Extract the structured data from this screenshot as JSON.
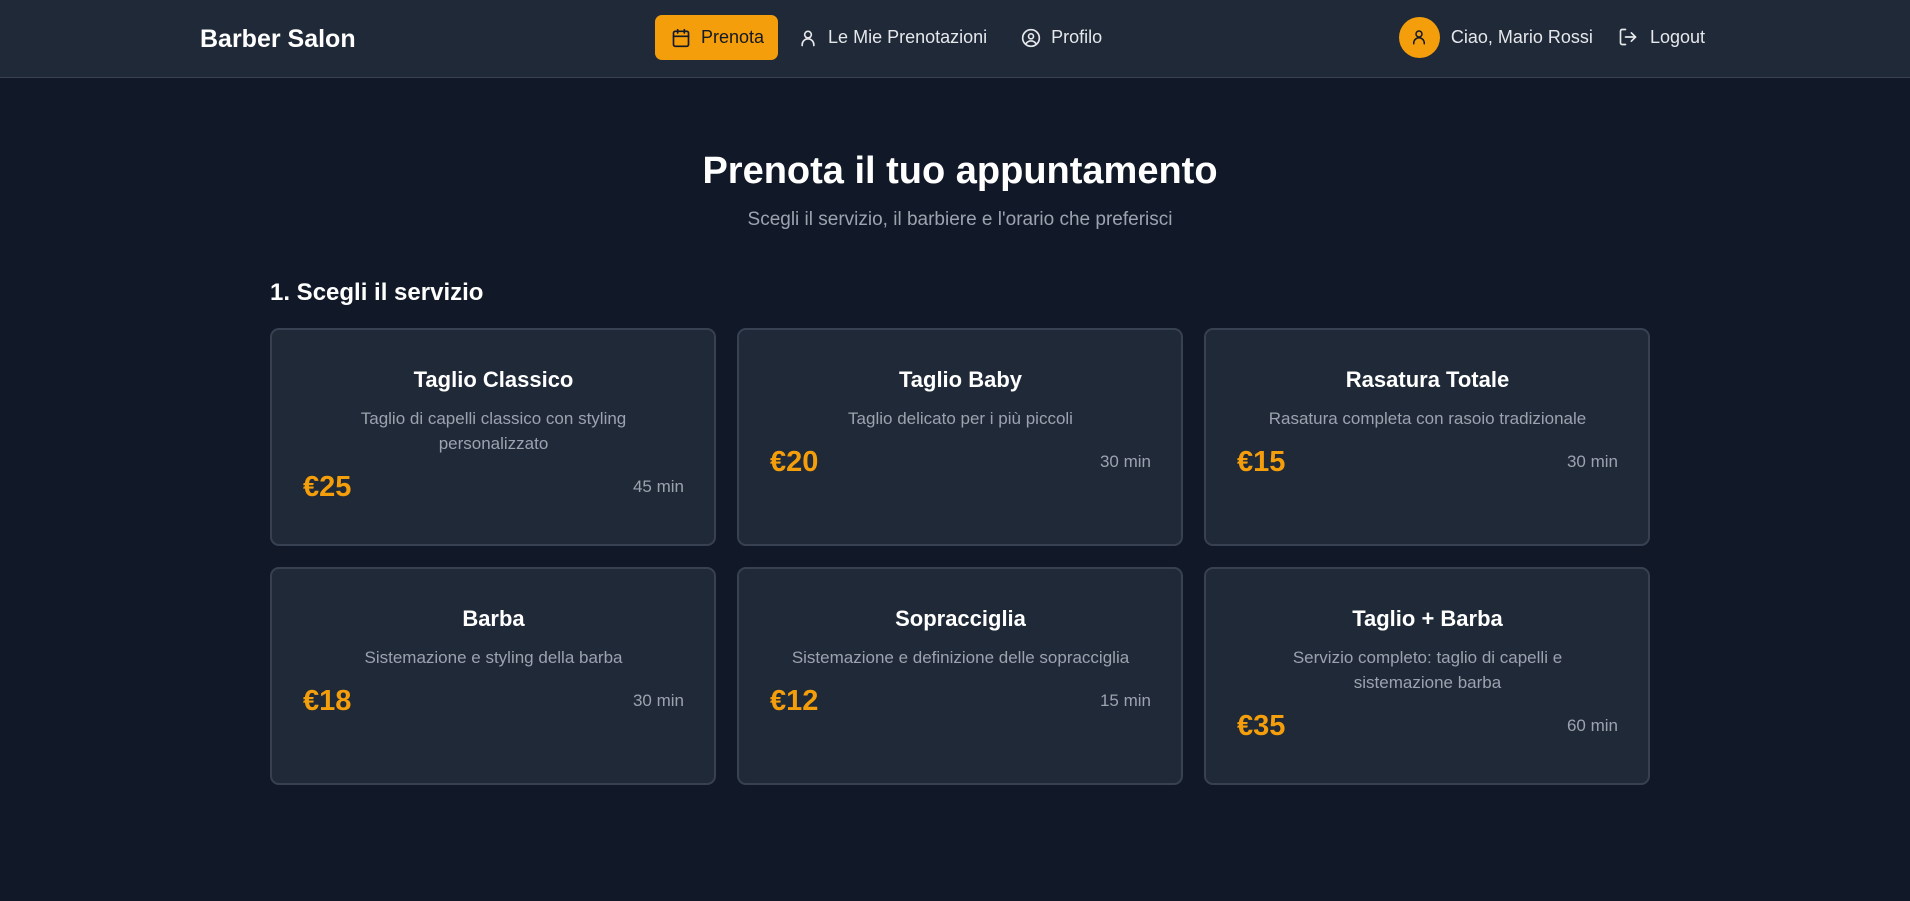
{
  "colors": {
    "background": "#111827",
    "navbar": "#1f2937",
    "card": "#1f2937",
    "accent": "#f59e0b",
    "muted_text": "#9ca3af"
  },
  "header": {
    "brand": "Barber Salon",
    "nav": [
      {
        "label": "Prenota",
        "icon": "calendar-icon",
        "active": true
      },
      {
        "label": "Le Mie Prenotazioni",
        "icon": "user-icon",
        "active": false
      },
      {
        "label": "Profilo",
        "icon": "user-circle-icon",
        "active": false
      }
    ],
    "greeting": "Ciao, Mario Rossi",
    "logout_label": "Logout",
    "avatar_icon": "user-icon"
  },
  "main": {
    "title": "Prenota il tuo appuntamento",
    "subtitle": "Scegli il servizio, il barbiere e l'orario che preferisci",
    "section_title": "1. Scegli il servizio",
    "services": [
      {
        "name": "Taglio Classico",
        "description": "Taglio di capelli classico con styling personalizzato",
        "price": "€25",
        "duration": "45 min"
      },
      {
        "name": "Taglio Baby",
        "description": "Taglio delicato per i più piccoli",
        "price": "€20",
        "duration": "30 min"
      },
      {
        "name": "Rasatura Totale",
        "description": "Rasatura completa con rasoio tradizionale",
        "price": "€15",
        "duration": "30 min"
      },
      {
        "name": "Barba",
        "description": "Sistemazione e styling della barba",
        "price": "€18",
        "duration": "30 min"
      },
      {
        "name": "Sopracciglia",
        "description": "Sistemazione e definizione delle sopracciglia",
        "price": "€12",
        "duration": "15 min"
      },
      {
        "name": "Taglio + Barba",
        "description": "Servizio completo: taglio di capelli e sistemazione barba",
        "price": "€35",
        "duration": "60 min"
      }
    ]
  }
}
